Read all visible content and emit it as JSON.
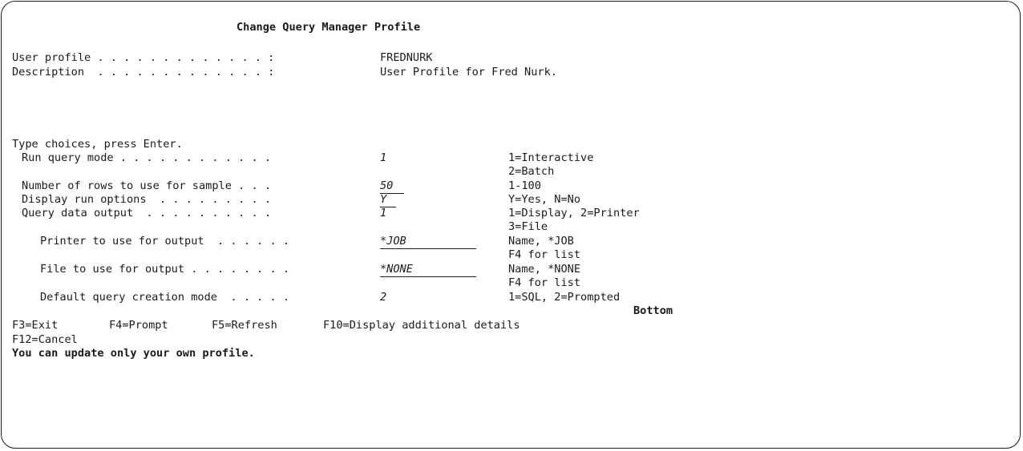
{
  "screen": {
    "title": "Change Query Manager Profile",
    "user_profile": {
      "label": "User profile . . . . . . . . . . . . . :",
      "value": "FREDNURK"
    },
    "description": {
      "label": "Description  . . . . . . . . . . . . . :",
      "value": "User Profile for Fred Nurk."
    },
    "instructions": "Type choices, press Enter.",
    "fields": {
      "run_query_mode": {
        "label": "Run query mode . . . . . . . . . . . .",
        "value": "1",
        "help": [
          "1=Interactive",
          "2=Batch"
        ]
      },
      "rows_for_sample": {
        "label": "Number of rows to use for sample . . .",
        "value": "50",
        "help": [
          "1-100"
        ]
      },
      "display_run_options": {
        "label": "Display run options  . . . . . . . . .",
        "value": "Y",
        "help": [
          "Y=Yes, N=No"
        ]
      },
      "query_data_output": {
        "label": "Query data output  . . . . . . . . . .",
        "value": "1",
        "help": [
          "1=Display, 2=Printer",
          "3=File"
        ]
      },
      "printer_for_output": {
        "label": "Printer to use for output  . . . . . .",
        "value": "*JOB",
        "help": [
          "Name, *JOB",
          "F4 for list"
        ]
      },
      "file_for_output": {
        "label": "File to use for output . . . . . . . .",
        "value": "*NONE",
        "help": [
          "Name, *NONE",
          "F4 for list"
        ]
      },
      "default_creation_mode": {
        "label": "Default query creation mode  . . . . .",
        "value": "2",
        "help": [
          "1=SQL, 2=Prompted"
        ]
      }
    },
    "scroll_indicator": "Bottom",
    "function_keys": {
      "f3": "F3=Exit",
      "f4": "F4=Prompt",
      "f5": "F5=Refresh",
      "f10": "F10=Display additional details",
      "f12": "F12=Cancel"
    },
    "message": "You can update only your own profile."
  }
}
